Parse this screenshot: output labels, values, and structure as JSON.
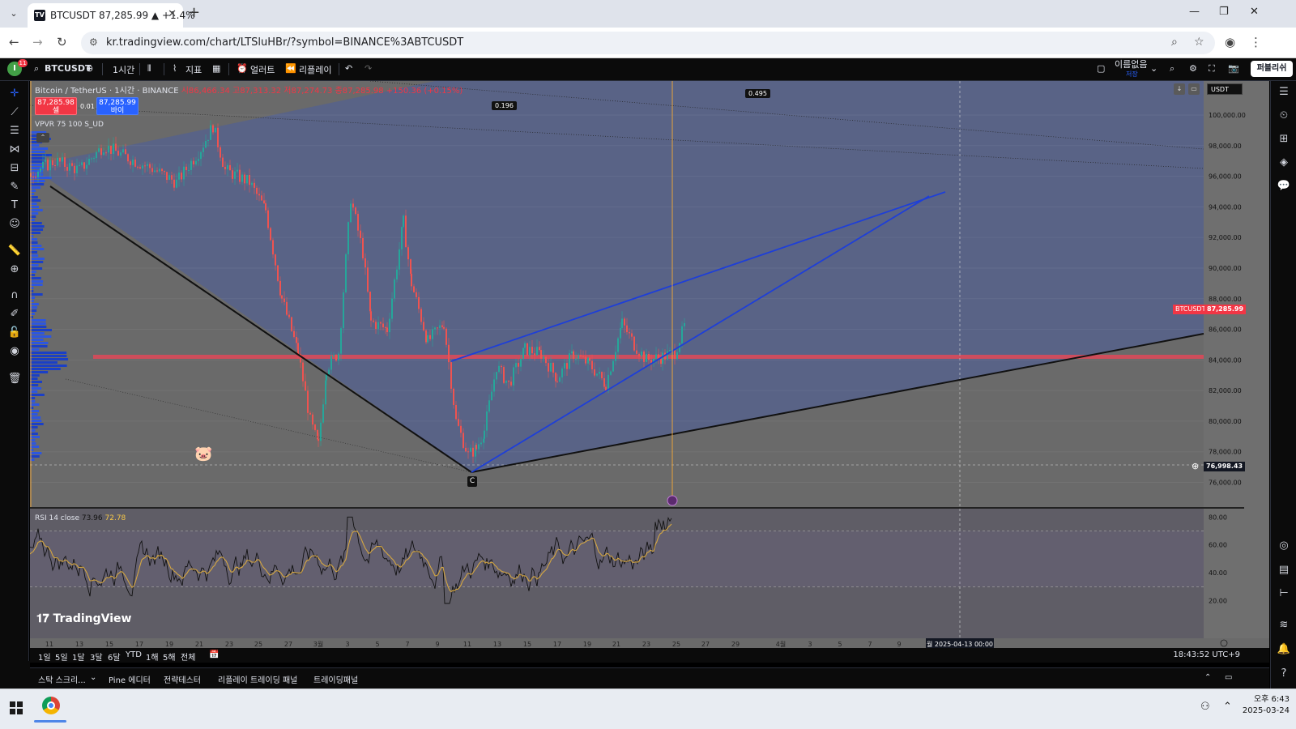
{
  "browser": {
    "tab_title": "BTCUSDT 87,285.99 ▲ +1.4%",
    "url": "kr.tradingview.com/chart/LTSluHBr/?symbol=BINANCE%3ABTCUSDT",
    "favicon_text": "TV"
  },
  "toolbar": {
    "avatar_letter": "I",
    "notifications_badge": "11",
    "symbol": "BTCUSDT",
    "interval": "1시간",
    "indicators_label": "지표",
    "alerts_label": "얼러트",
    "replay_label": "리플레이",
    "layout_name": "이름없음",
    "layout_status": "저장",
    "publish_label": "퍼블리쉬"
  },
  "legend": {
    "title": "Bitcoin / TetherUS · 1시간 · BINANCE",
    "ohlc": "시86,466.34 고87,313.32 저87,274.73 종87,285.98 +150.36 (+0.15%)",
    "sell_price": "87,285.98",
    "sell_label": "셀",
    "buy_price": "87,285.99",
    "buy_label": "바이",
    "spread": "0.01",
    "vpvr": "VPVR 75 100 S_UD",
    "rsi_name": "RSI 14 close",
    "rsi_value": "73.96",
    "rsi_ma": "72.78",
    "currency": "USDT",
    "logo": "TradingView"
  },
  "price_axis": {
    "ticks": [
      "100,000.00",
      "98,000.00",
      "96,000.00",
      "94,000.00",
      "92,000.00",
      "90,000.00",
      "88,000.00",
      "86,000.00",
      "84,000.00",
      "82,000.00",
      "80,000.00",
      "78,000.00",
      "76,000.00"
    ],
    "current_symbol": "BTCUSDT",
    "current_price": "87,285.99",
    "crosshair_price": "76,998.43"
  },
  "rsi_axis": {
    "ticks": [
      "80.00",
      "60.00",
      "40.00",
      "20.00"
    ]
  },
  "time_axis": {
    "ticks": [
      "11",
      "13",
      "15",
      "17",
      "19",
      "21",
      "23",
      "25",
      "27",
      "3월",
      "3",
      "5",
      "7",
      "9",
      "11",
      "13",
      "15",
      "17",
      "19",
      "21",
      "23",
      "25",
      "27",
      "29",
      "4월",
      "3",
      "5",
      "7",
      "9"
    ],
    "crosshair": "월 2025-04-13   00:00"
  },
  "drawings": {
    "fib_a": "0.196",
    "fib_b": "0.495",
    "point_c": "C"
  },
  "range_bar": {
    "ranges": [
      "1일",
      "5일",
      "1달",
      "3달",
      "6달",
      "YTD",
      "1해",
      "5해",
      "전체"
    ],
    "clock": "18:43:52 UTC+9"
  },
  "bottom_tabs": [
    "스탁 스크리...",
    "Pine 에디터",
    "전략테스터",
    "리플레이 트레이딩 패널",
    "트레이딩패널"
  ],
  "taskbar": {
    "time": "오후 6:43",
    "date": "2025-03-24"
  },
  "colors": {
    "accent_red": "#f23645",
    "accent_blue": "#2962ff",
    "pattern_blue": "#1e3fd8",
    "rsi_ma": "#d4a640"
  }
}
